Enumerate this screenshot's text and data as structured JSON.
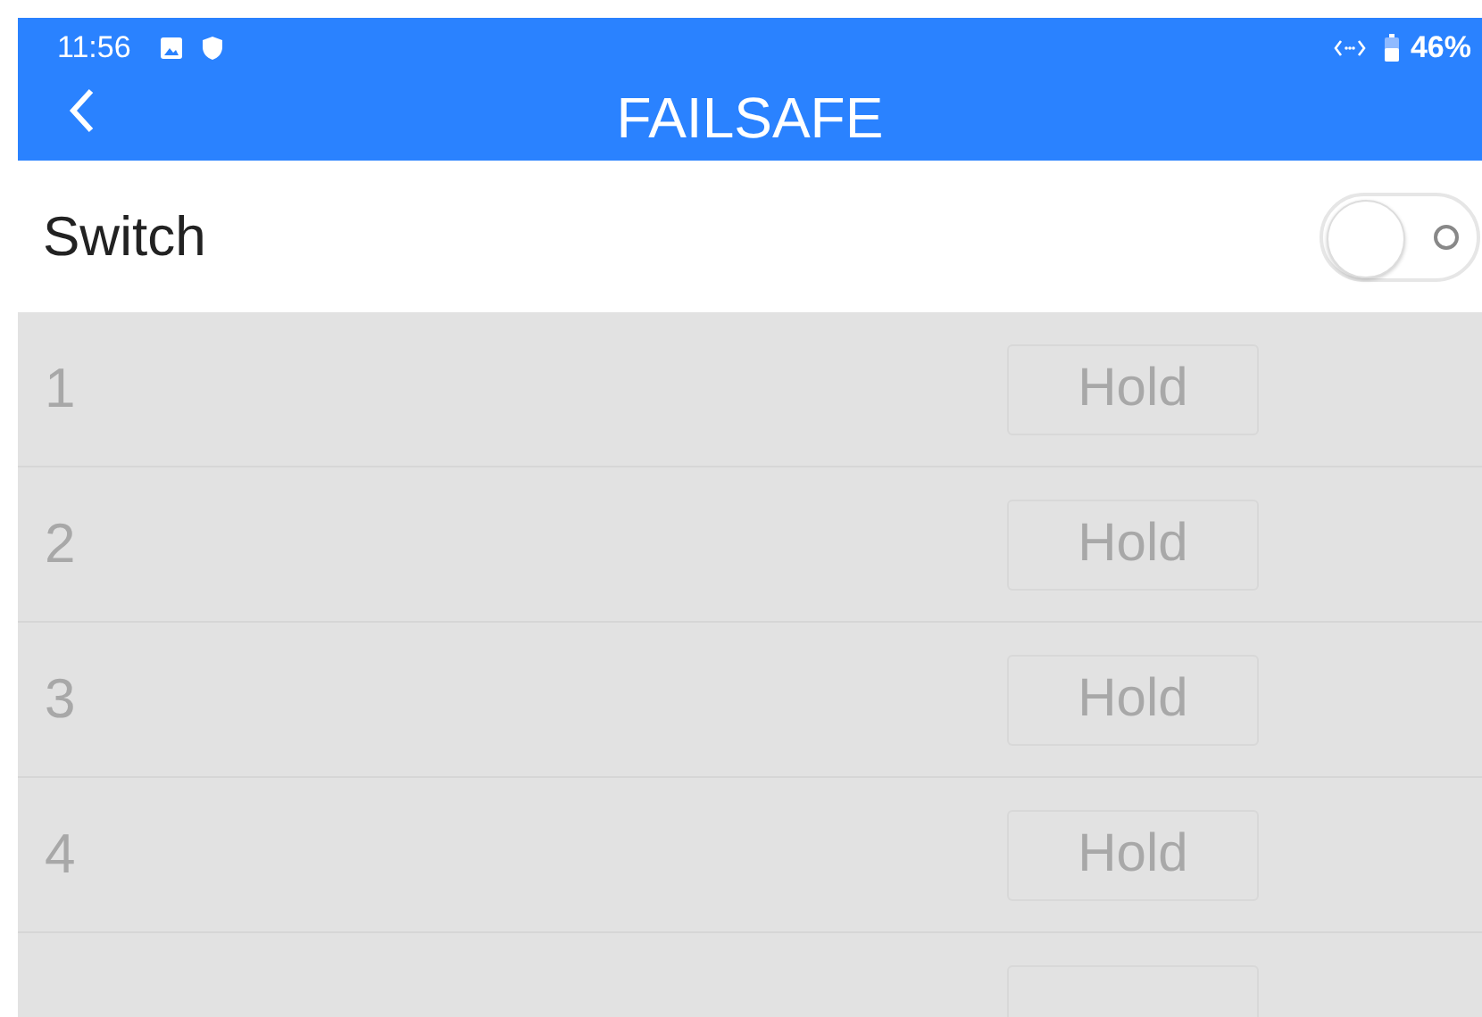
{
  "status_bar": {
    "time": "11:56",
    "battery_text": "46%"
  },
  "header": {
    "title": "FAILSAFE"
  },
  "switch": {
    "label": "Switch",
    "on": false
  },
  "channels": [
    {
      "number": "1",
      "value": "Hold",
      "disabled": true
    },
    {
      "number": "2",
      "value": "Hold",
      "disabled": true
    },
    {
      "number": "3",
      "value": "Hold",
      "disabled": true
    },
    {
      "number": "4",
      "value": "Hold",
      "disabled": true
    }
  ],
  "more_rows_below": true
}
